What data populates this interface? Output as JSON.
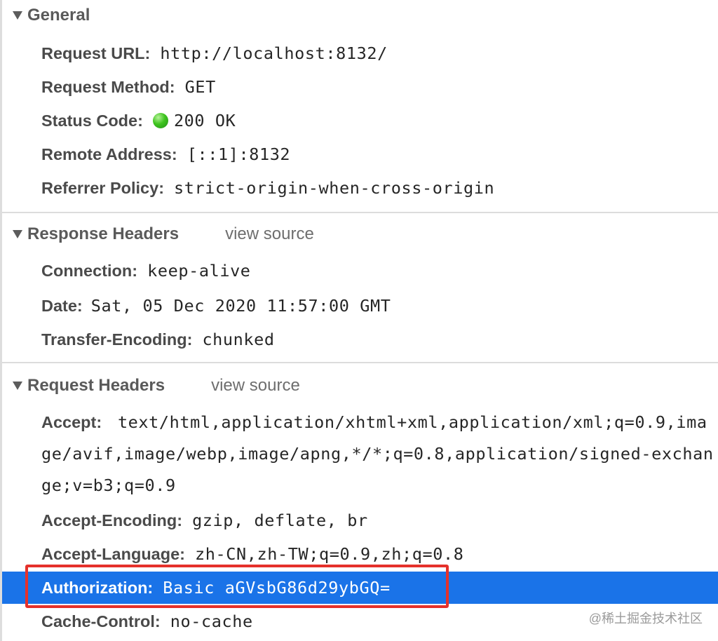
{
  "general": {
    "title": "General",
    "rows": [
      {
        "key": "Request URL:",
        "value": "http://localhost:8132/"
      },
      {
        "key": "Request Method:",
        "value": "GET"
      },
      {
        "key": "Status Code:",
        "value": "200 OK"
      },
      {
        "key": "Remote Address:",
        "value": "[::1]:8132"
      },
      {
        "key": "Referrer Policy:",
        "value": "strict-origin-when-cross-origin"
      }
    ]
  },
  "response_headers": {
    "title": "Response Headers",
    "view_source": "view source",
    "rows": [
      {
        "key": "Connection:",
        "value": "keep-alive"
      },
      {
        "key": "Date:",
        "value": "Sat, 05 Dec 2020 11:57:00 GMT"
      },
      {
        "key": "Transfer-Encoding:",
        "value": "chunked"
      }
    ]
  },
  "request_headers": {
    "title": "Request Headers",
    "view_source": "view source",
    "rows": [
      {
        "key": "Accept:",
        "value": "text/html,application/xhtml+xml,application/xml;q=0.9,image/avif,image/webp,image/apng,*/*;q=0.8,application/signed-exchange;v=b3;q=0.9"
      },
      {
        "key": "Accept-Encoding:",
        "value": "gzip, deflate, br"
      },
      {
        "key": "Accept-Language:",
        "value": "zh-CN,zh-TW;q=0.9,zh;q=0.8"
      },
      {
        "key": "Authorization:",
        "value": "Basic aGVsbG86d29ybGQ="
      },
      {
        "key": "Cache-Control:",
        "value": "no-cache"
      }
    ]
  },
  "status_indicator_color": "#3ec41e",
  "selection_color": "#1a73e8",
  "highlight_color": "#e5312b",
  "watermark": "@稀土掘金技术社区"
}
